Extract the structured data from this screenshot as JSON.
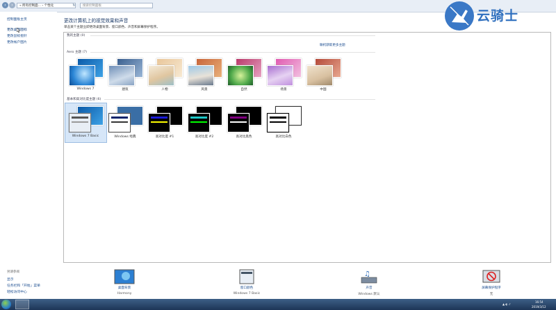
{
  "address": {
    "breadcrumb": "« 所有控制面... › 个性化",
    "search_placeholder": "搜索控制面板"
  },
  "sidebar": {
    "home": "控制面板主页",
    "links": [
      "更改桌面图标",
      "更改鼠标指针",
      "更改帐户图片"
    ],
    "see_also_title": "另请参阅",
    "see_also": [
      "显示",
      "任务栏和「开始」菜单",
      "轻松访问中心"
    ]
  },
  "main": {
    "heading": "更改计算机上的视觉效果和声音",
    "subtitle": "单击某个主题立即更改桌面背景、窗口颜色、声音和屏幕保护程序。",
    "my_themes": "我的主题 (0)",
    "online_link": "联机获取更多主题",
    "aero_title": "Aero 主题 (7)",
    "aero_themes": [
      "Windows 7",
      "建筑",
      "人物",
      "风景",
      "自然",
      "场景",
      "中国"
    ],
    "basic_title": "基本和高对比度主题 (6)",
    "basic_themes": [
      "Windows 7 Basic",
      "Windows 经典",
      "高对比度 #1",
      "高对比度 #2",
      "高对比黑色",
      "高对比白色"
    ]
  },
  "bottom": [
    {
      "label": "桌面背景",
      "sub": "Harmony",
      "icon": "desktop-background-icon"
    },
    {
      "label": "窗口颜色",
      "sub": "Windows 7 Basic",
      "icon": "window-color-icon"
    },
    {
      "label": "声音",
      "sub": "Windows 默认",
      "icon": "sound-icon"
    },
    {
      "label": "屏幕保护程序",
      "sub": "无",
      "icon": "screensaver-icon"
    }
  ],
  "taskbar": {
    "time": "16:54",
    "date": "2019/3/12"
  },
  "watermark": {
    "text": "云骑士"
  }
}
